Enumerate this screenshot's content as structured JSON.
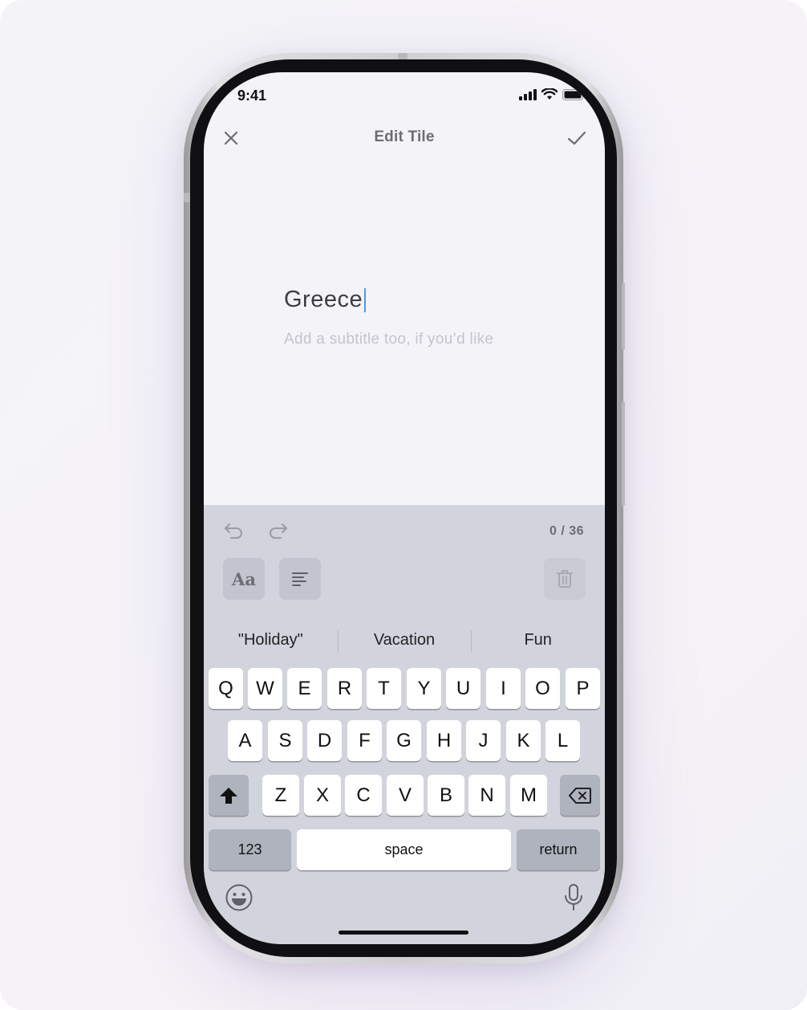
{
  "status_bar": {
    "time": "9:41"
  },
  "nav": {
    "title": "Edit Tile"
  },
  "editor": {
    "title_value": "Greece",
    "subtitle_placeholder": "Add a subtitle too, if you’d like"
  },
  "toolbar": {
    "char_count": "0 / 36",
    "font_button_label": "Aa"
  },
  "suggestions": [
    "\"Holiday\"",
    "Vacation",
    "Fun"
  ],
  "keyboard": {
    "row1": [
      "Q",
      "W",
      "E",
      "R",
      "T",
      "Y",
      "U",
      "I",
      "O",
      "P"
    ],
    "row2": [
      "A",
      "S",
      "D",
      "F",
      "G",
      "H",
      "J",
      "K",
      "L"
    ],
    "row3": [
      "Z",
      "X",
      "C",
      "V",
      "B",
      "N",
      "M"
    ],
    "numbers_label": "123",
    "space_label": "space",
    "return_label": "return"
  },
  "colors": {
    "keyboard_bg": "#d1d4dd",
    "caret": "#4a9be8",
    "screen_bg": "#f4f4f8"
  }
}
